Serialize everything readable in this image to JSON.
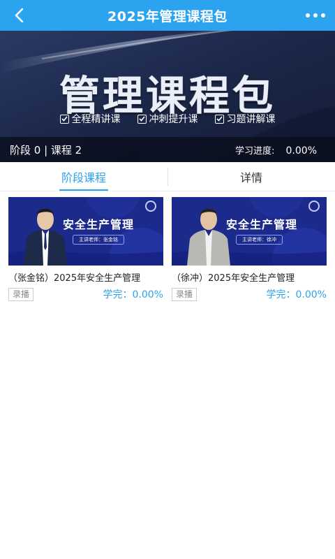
{
  "header": {
    "title": "2025年管理课程包",
    "back_icon": "chevron-left-icon",
    "more_icon": "more-horizontal-icon",
    "bg_color": "#2ba3ee"
  },
  "banner": {
    "title": "管理课程包",
    "features": [
      "全程精讲课",
      "冲刺提升课",
      "习题讲解课"
    ],
    "stage_course": "阶段 0 | 课程 2",
    "progress_label": "学习进度:",
    "progress_value": "0.00%"
  },
  "tabs": [
    {
      "label": "阶段课程",
      "active": true
    },
    {
      "label": "详情",
      "active": false
    }
  ],
  "courses": [
    {
      "thumb_title": "安全生产管理",
      "thumb_teacher": "主讲老师：张金铭",
      "title": "（张金铭）2025年安全生产管理",
      "badge": "录播",
      "done": "学完：0.00%"
    },
    {
      "thumb_title": "安全生产管理",
      "thumb_teacher": "主讲老师：徐冲",
      "title": "（徐冲）2025年安全生产管理",
      "badge": "录播",
      "done": "学完：0.00%"
    }
  ],
  "colors": {
    "accent": "#2ba3ee",
    "banner_bg": "#1a2544",
    "thumb_bg": "#1c2a8c"
  }
}
